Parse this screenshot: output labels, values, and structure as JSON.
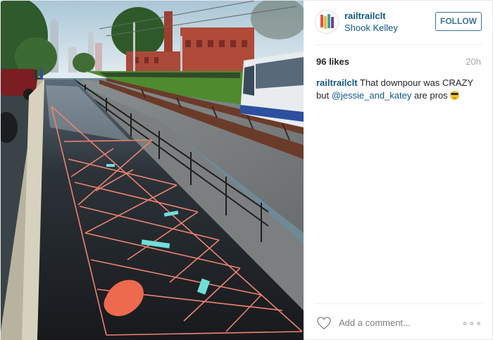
{
  "post": {
    "photo_icon": "trail-photo",
    "username": "railtrailclt",
    "location": "Shook Kelley",
    "follow_label": "FOLLOW",
    "likes": "96 likes",
    "time_ago": "20h",
    "caption": {
      "user": "railtrailclt",
      "text_before": "That downpour was CRAZY but",
      "mention": "@jessie_and_katey",
      "text_after": "are pros",
      "emoji": "sunglasses-emoji"
    },
    "comment_placeholder": "Add a comment...",
    "more_label": "∘∘∘",
    "like_icon": "heart-outline-icon",
    "avatar_icon": "railtrail-logo"
  },
  "colors": {
    "link": "#125688",
    "follow": "#3f729b",
    "muted": "#a5a7aa"
  }
}
